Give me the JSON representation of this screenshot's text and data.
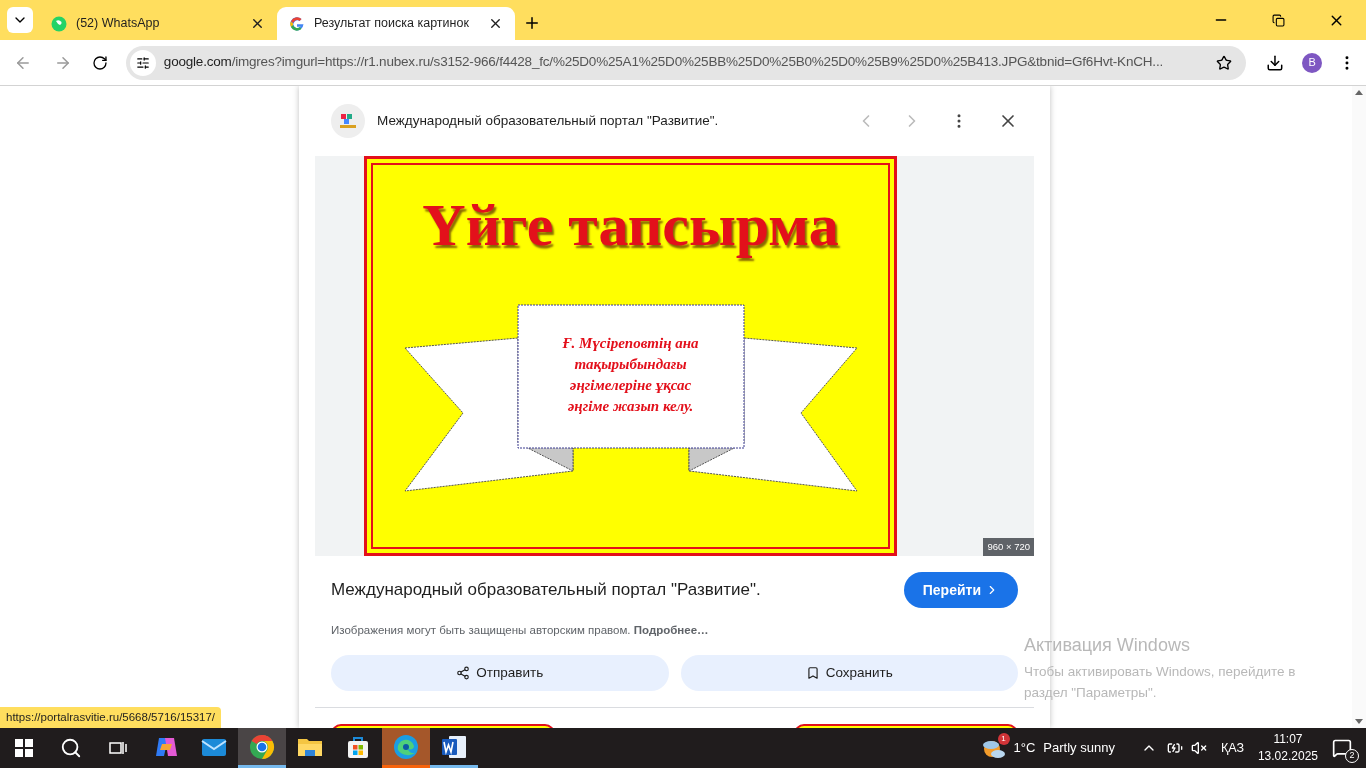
{
  "tabs": [
    {
      "kind": "whatsapp",
      "title": "(52) WhatsApp",
      "selected": false
    },
    {
      "kind": "google",
      "title": "Результат поиска картинок",
      "selected": true
    }
  ],
  "address_bar": {
    "domain": "google.com",
    "path": "/imgres?imgurl=https://r1.nubex.ru/s3152-966/f4428_fc/%25D0%25A1%25D0%25BB%25D0%25B0%25D0%25B9%25D0%25B413.JPG&tbnid=Gf6Hvt-KnCH..."
  },
  "profile": {
    "initial": "B"
  },
  "viewer": {
    "source_name": "Международный образовательный портал \"Развитие\".",
    "slide": {
      "title": "Үйге тапсырма",
      "lines": [
        "Ғ. Мүсіреповтің ана",
        "тақырыбындағы",
        "әңгімелеріне ұқсас",
        "әңгіме жазып келу."
      ]
    },
    "dimensions": "960 × 720",
    "title": "Международный образовательный портал \"Развитие\".",
    "visit_button": "Перейти",
    "notice": "Изображения могут быть защищены авторским правом. **Подробнее…**",
    "share_button": "Отправить",
    "save_button": "Сохранить"
  },
  "status_url": "https://portalrasvitie.ru/5668/5716/15317/",
  "activation": {
    "title": "Активация Windows",
    "text": "Чтобы активировать Windows, перейдите в раздел \"Параметры\"."
  },
  "taskbar": {
    "apps": [
      {
        "kind": "copilot",
        "selected": false,
        "open": false,
        "flashing": false
      },
      {
        "kind": "mail",
        "selected": false,
        "open": false,
        "flashing": false
      },
      {
        "kind": "chrome",
        "selected": true,
        "open": true,
        "flashing": false
      },
      {
        "kind": "explorer",
        "selected": false,
        "open": false,
        "flashing": false
      },
      {
        "kind": "store",
        "selected": false,
        "open": false,
        "flashing": false
      },
      {
        "kind": "edge",
        "selected": false,
        "open": true,
        "flashing": true
      },
      {
        "kind": "word",
        "selected": false,
        "open": true,
        "flashing": false
      }
    ],
    "weather": {
      "badge": "1",
      "temperature": "1°C",
      "condition": "Partly sunny"
    },
    "language": "ҚАЗ",
    "time": "11:07",
    "date": "13.02.2025",
    "notifications": "2"
  }
}
